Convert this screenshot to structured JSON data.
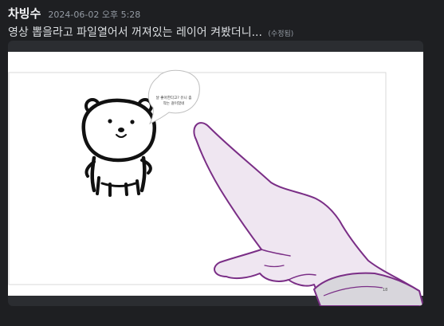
{
  "message": {
    "author": "차빙수",
    "timestamp": "2024-06-02 오후 5:28",
    "content": "영상 뽑을라고 파일열어서 꺼져있는 레이어 켜봤더니...",
    "edited_label": "(수정됨)"
  },
  "attachment": {
    "bubble_line1": "날 좋아한다고?  유니 좀",
    "bubble_line2": "작는 걸이었네",
    "corner_mark": "18"
  },
  "colors": {
    "background": "#1e1f22",
    "attachment_frame": "#2b2d31",
    "hand_outline": "#7a2e86",
    "hand_fill": "#efe6f1"
  }
}
